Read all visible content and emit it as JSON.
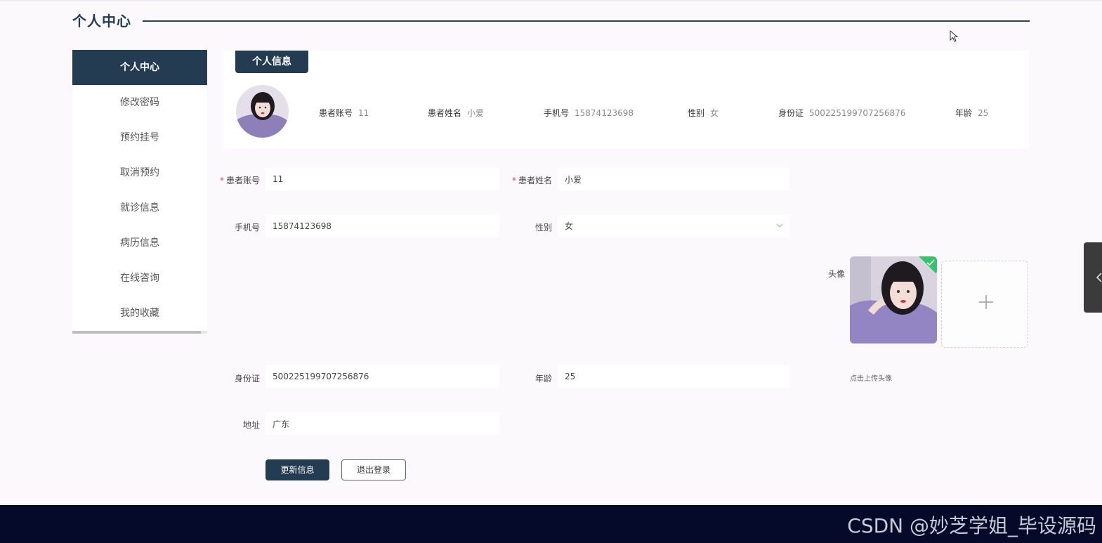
{
  "header": {
    "title": "个人中心"
  },
  "sidebar": {
    "items": [
      {
        "label": "个人中心"
      },
      {
        "label": "修改密码"
      },
      {
        "label": "预约挂号"
      },
      {
        "label": "取消预约"
      },
      {
        "label": "就诊信息"
      },
      {
        "label": "病历信息"
      },
      {
        "label": "在线咨询"
      },
      {
        "label": "我的收藏"
      }
    ],
    "active_index": 0
  },
  "info_card": {
    "tab_label": "个人信息",
    "fields": [
      {
        "label": "患者账号",
        "value": "11"
      },
      {
        "label": "患者姓名",
        "value": "小爱"
      },
      {
        "label": "手机号",
        "value": "15874123698"
      },
      {
        "label": "性别",
        "value": "女"
      },
      {
        "label": "身份证",
        "value": "500225199707256876"
      },
      {
        "label": "年龄",
        "value": "25"
      }
    ]
  },
  "form": {
    "account": {
      "label": "患者账号",
      "value": "11",
      "required": "*"
    },
    "name": {
      "label": "患者姓名",
      "value": "小爱",
      "required": "*"
    },
    "phone": {
      "label": "手机号",
      "value": "15874123698"
    },
    "gender": {
      "label": "性别",
      "value": "女"
    },
    "avatar": {
      "label": "头像",
      "hint": "点击上传头像"
    },
    "id_card": {
      "label": "身份证",
      "value": "500225199707256876"
    },
    "age": {
      "label": "年龄",
      "value": "25"
    },
    "address": {
      "label": "地址",
      "value": "广东"
    }
  },
  "buttons": {
    "update": "更新信息",
    "logout": "退出登录"
  },
  "footer": {
    "watermark": "CSDN @妙芝学姐_毕设源码"
  },
  "colors": {
    "primary": "#233c51",
    "success": "#35c46b",
    "required": "#e34d4d",
    "footer": "#050a2a"
  }
}
